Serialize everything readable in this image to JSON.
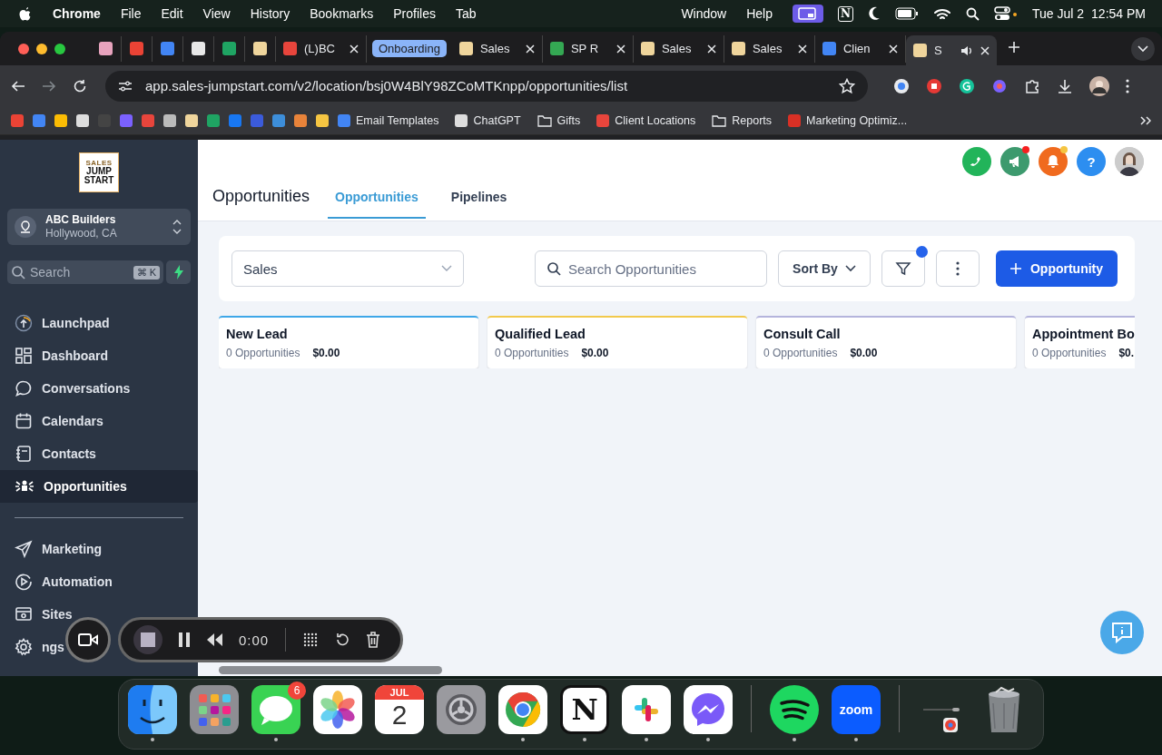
{
  "menubar": {
    "app": "Chrome",
    "menus": [
      "File",
      "Edit",
      "View",
      "History",
      "Bookmarks",
      "Profiles",
      "Tab"
    ],
    "right_menus": [
      "Window",
      "Help"
    ],
    "notion_label": "N",
    "date": "Tue Jul 2",
    "time": "12:54 PM"
  },
  "tabs": [
    {
      "kind": "pinned",
      "color": "#e7a3bd",
      "selected": false,
      "audio": false
    },
    {
      "kind": "pinned",
      "color": "#ea4335",
      "selected": false,
      "audio": false
    },
    {
      "kind": "pinned",
      "color": "#4285f4",
      "selected": false,
      "audio": false
    },
    {
      "kind": "pinned",
      "color": "#e8e8e8",
      "selected": false,
      "audio": false
    },
    {
      "kind": "pinned",
      "color": "#1fa463",
      "selected": false,
      "audio": false
    },
    {
      "kind": "pinned",
      "color": "#efd59c",
      "selected": false,
      "audio": false
    },
    {
      "kind": "page",
      "label": "(L)BC",
      "color": "#e8453c",
      "selected": false,
      "audio": false
    },
    {
      "kind": "page",
      "label": "Sales",
      "group_label": "Onboarding",
      "color": "#efd59c",
      "selected": false,
      "audio": false
    },
    {
      "kind": "page",
      "label": "SP R",
      "color": "#34a853",
      "selected": false,
      "audio": false
    },
    {
      "kind": "page",
      "label": "Sales",
      "color": "#efd59c",
      "selected": false,
      "audio": false
    },
    {
      "kind": "page",
      "label": "Sales",
      "color": "#efd59c",
      "selected": false,
      "audio": false
    },
    {
      "kind": "page",
      "label": "Clien",
      "color": "#4285f4",
      "selected": false,
      "audio": false
    },
    {
      "kind": "page",
      "label": "S",
      "color": "#efd59c",
      "selected": true,
      "audio": true
    }
  ],
  "address": {
    "url": "app.sales-jumpstart.com/v2/location/bsj0W4BlY98ZCoMTKnpp/opportunities/list"
  },
  "bookmarks": [
    {
      "kind": "site",
      "color": "#ea4335"
    },
    {
      "kind": "site",
      "color": "#4285f4"
    },
    {
      "kind": "site",
      "color": "#fbbc04"
    },
    {
      "kind": "site",
      "color": "#dddddd"
    },
    {
      "kind": "site",
      "color": "#444444"
    },
    {
      "kind": "site",
      "color": "#7b61ff"
    },
    {
      "kind": "site",
      "color": "#e8453c"
    },
    {
      "kind": "site",
      "color": "#bbbbbb"
    },
    {
      "kind": "site",
      "color": "#efd59c"
    },
    {
      "kind": "site",
      "color": "#1fa463"
    },
    {
      "kind": "site",
      "color": "#1877f2"
    },
    {
      "kind": "site",
      "color": "#3b5bdb"
    },
    {
      "kind": "site",
      "color": "#3d8eda"
    },
    {
      "kind": "site",
      "color": "#e8833a"
    },
    {
      "kind": "site",
      "color": "#f5c542"
    },
    {
      "kind": "site",
      "label": "Email Templates",
      "color": "#4285f4"
    },
    {
      "kind": "site",
      "label": "ChatGPT",
      "color": "#dddddd"
    },
    {
      "kind": "folder",
      "label": "Gifts"
    },
    {
      "kind": "site",
      "label": "Client Locations",
      "color": "#e8453c"
    },
    {
      "kind": "folder",
      "label": "Reports"
    },
    {
      "kind": "site",
      "label": "Marketing Optimiz...",
      "color": "#d93025"
    }
  ],
  "sidebar": {
    "logo": {
      "tagline": "SALES",
      "lines": [
        "JUMP",
        "START"
      ]
    },
    "location": {
      "name": "ABC Builders",
      "address": "Hollywood, CA"
    },
    "search": {
      "placeholder": "Search",
      "shortcut": "⌘ K"
    },
    "nav": [
      {
        "label": "Launchpad",
        "kind": "launchpad",
        "selected": false
      },
      {
        "label": "Dashboard",
        "kind": "dashboard",
        "selected": false
      },
      {
        "label": "Conversations",
        "kind": "conversations",
        "selected": false
      },
      {
        "label": "Calendars",
        "kind": "calendars",
        "selected": false
      },
      {
        "label": "Contacts",
        "kind": "contacts",
        "selected": false
      },
      {
        "label": "Opportunities",
        "kind": "opportunities",
        "selected": true
      }
    ],
    "nav_secondary": [
      {
        "label": "Marketing",
        "kind": "marketing",
        "selected": false
      },
      {
        "label": "Automation",
        "kind": "automation",
        "selected": false
      },
      {
        "label": "Sites",
        "kind": "sites",
        "selected": false
      },
      {
        "label": "ngs",
        "kind": "settings",
        "selected": false
      }
    ]
  },
  "header_buttons": [
    {
      "kind": "phone"
    },
    {
      "kind": "megaphone",
      "badge": {
        "color": "#f52020"
      }
    },
    {
      "kind": "bell",
      "badge": {
        "color": "#f5c542"
      }
    },
    {
      "kind": "help",
      "label": "?"
    },
    {
      "kind": "avatar"
    }
  ],
  "page": {
    "title": "Opportunities",
    "tabs": [
      {
        "label": "Opportunities",
        "selected": true
      },
      {
        "label": "Pipelines",
        "selected": false
      }
    ]
  },
  "toolbar": {
    "pipeline": "Sales",
    "search_placeholder": "Search Opportunities",
    "sort_label": "Sort By",
    "filter_active": true,
    "add_label": "Opportunity"
  },
  "stages": [
    {
      "name": "New Lead",
      "count": "0 Opportunities",
      "value": "$0.00",
      "color": "#3ea7e8"
    },
    {
      "name": "Qualified Lead",
      "count": "0 Opportunities",
      "value": "$0.00",
      "color": "#f2c94c"
    },
    {
      "name": "Consult Call",
      "count": "0 Opportunities",
      "value": "$0.00",
      "color": "#b4b4dc"
    },
    {
      "name": "Appointment Bo",
      "count": "0 Opportunities",
      "value": "$0.",
      "color": "#b4b4dc"
    }
  ],
  "recorder": {
    "time": "0:00"
  },
  "dock": [
    {
      "kind": "finder",
      "running": true
    },
    {
      "kind": "launchpad",
      "running": false
    },
    {
      "kind": "messages",
      "running": true,
      "badge": "6"
    },
    {
      "kind": "photos",
      "running": false
    },
    {
      "kind": "calendar",
      "running": false,
      "month": "JUL",
      "day": "2"
    },
    {
      "kind": "settings",
      "running": false
    },
    {
      "kind": "chrome",
      "running": true
    },
    {
      "kind": "notion",
      "running": true,
      "label": "N"
    },
    {
      "kind": "slack",
      "running": true
    },
    {
      "kind": "messenger",
      "running": true
    },
    {
      "kind": "separator"
    },
    {
      "kind": "spotify",
      "running": true
    },
    {
      "kind": "zoom",
      "running": true,
      "label": "zoom"
    },
    {
      "kind": "separator"
    },
    {
      "kind": "window",
      "running": false
    },
    {
      "kind": "trash",
      "running": false
    }
  ]
}
